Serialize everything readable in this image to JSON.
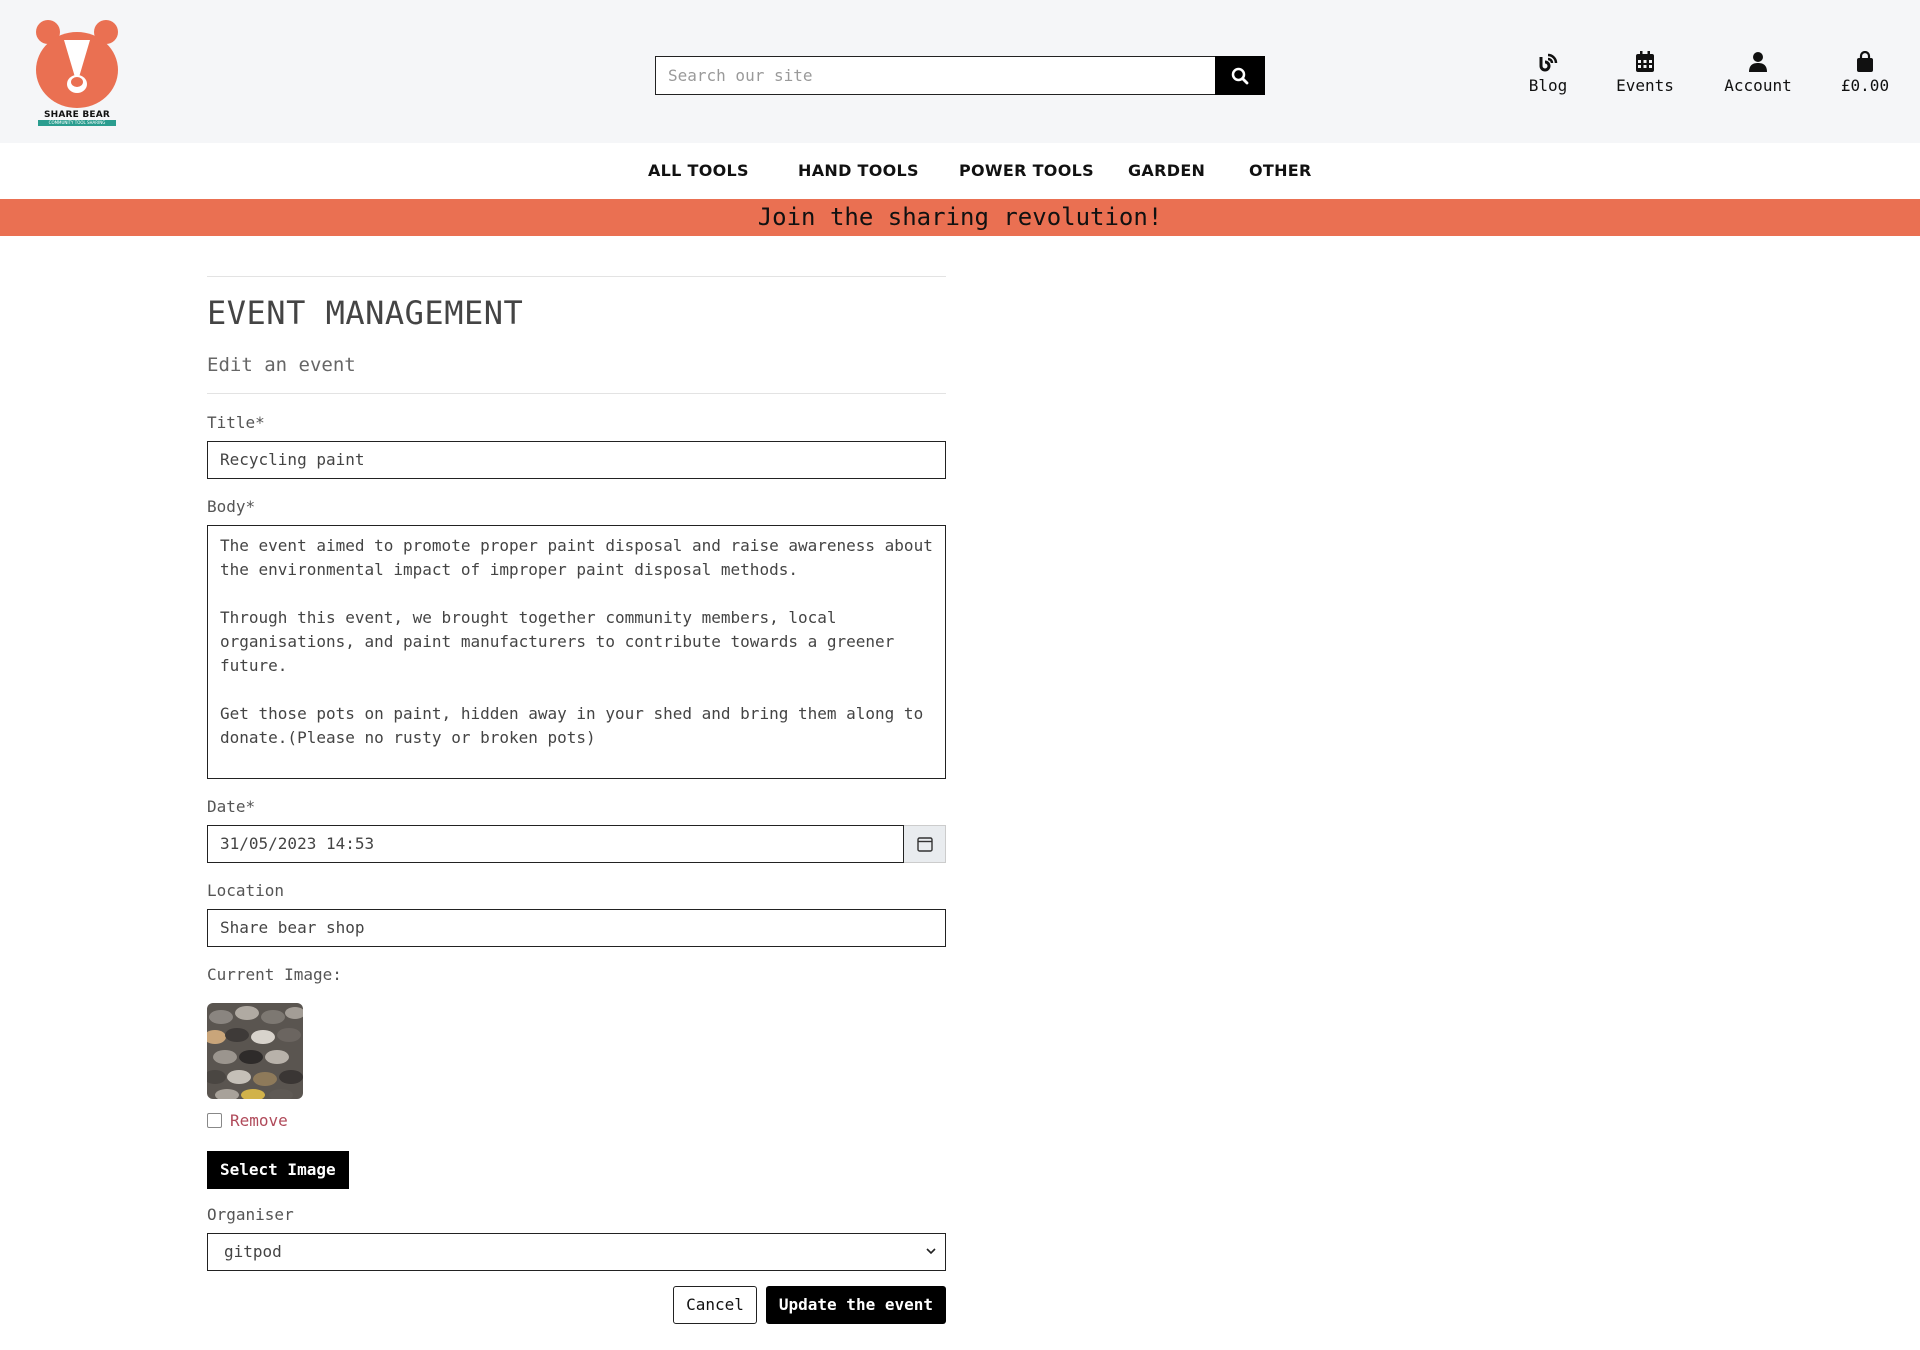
{
  "brand": {
    "logo_text": "SHARE BEAR",
    "logo_tagline": "COMMUNITY TOOL SHARING",
    "accent_color": "#ea7052",
    "teal_color": "#2a9d8f"
  },
  "search": {
    "placeholder": "Search our site",
    "icon": "search-icon"
  },
  "header_links": {
    "blog": {
      "label": "Blog",
      "icon": "blog-icon"
    },
    "events": {
      "label": "Events",
      "icon": "calendar-icon"
    },
    "account": {
      "label": "Account",
      "icon": "user-icon"
    },
    "basket": {
      "label": "£0.00",
      "icon": "shopping-bag-icon"
    }
  },
  "nav": {
    "items": [
      "ALL TOOLS",
      "HAND TOOLS",
      "POWER TOOLS",
      "GARDEN",
      "OTHER"
    ]
  },
  "banner": {
    "text": "Join the sharing revolution!"
  },
  "page": {
    "title": "EVENT MANAGEMENT",
    "subtitle": "Edit an event"
  },
  "form": {
    "title_label": "Title*",
    "title_value": "Recycling paint",
    "body_label": "Body*",
    "body_value": "The event aimed to promote proper paint disposal and raise awareness about the environmental impact of improper paint disposal methods.\n\nThrough this event, we brought together community members, local organisations, and paint manufacturers to contribute towards a greener future.\n\nGet those pots on paint, hidden away in your shed and bring them along to donate.(Please no rusty or broken pots)",
    "date_label": "Date*",
    "date_value": "31/05/2023 14:53",
    "location_label": "Location",
    "location_value": "Share bear shop",
    "current_image_label": "Current Image:",
    "remove_label": "Remove",
    "select_image_label": "Select Image",
    "organiser_label": "Organiser",
    "organiser_value": "gitpod",
    "cancel_label": "Cancel",
    "submit_label": "Update the event"
  }
}
